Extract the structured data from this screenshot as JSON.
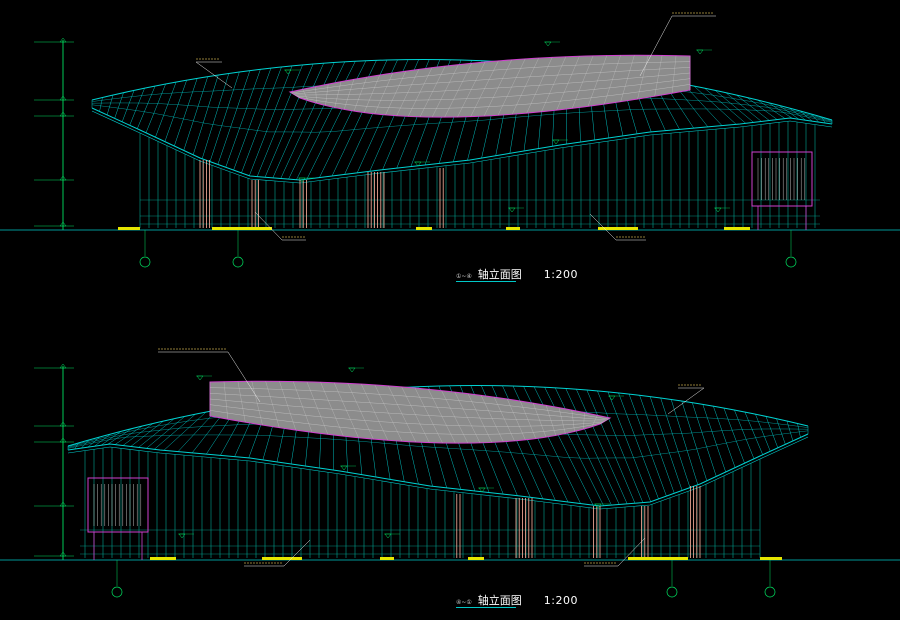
{
  "drawings": [
    {
      "id": "elevation-1",
      "tag": "①~④",
      "title": "轴立面图",
      "scale": "1:200"
    },
    {
      "id": "elevation-2",
      "tag": "④~①",
      "title": "轴立面图",
      "scale": "1:200"
    }
  ],
  "colors": {
    "background": "#000000",
    "roof_grid": "#00d2d2",
    "facade": "#00b4a0",
    "dimension": "#00e060",
    "accent": "#d040d0",
    "skylight": "#8c8c8c",
    "column": "#ffb4a0",
    "ground": "#00c8c8",
    "base_pad": "#e6e600",
    "label": "#e8e8e8"
  }
}
